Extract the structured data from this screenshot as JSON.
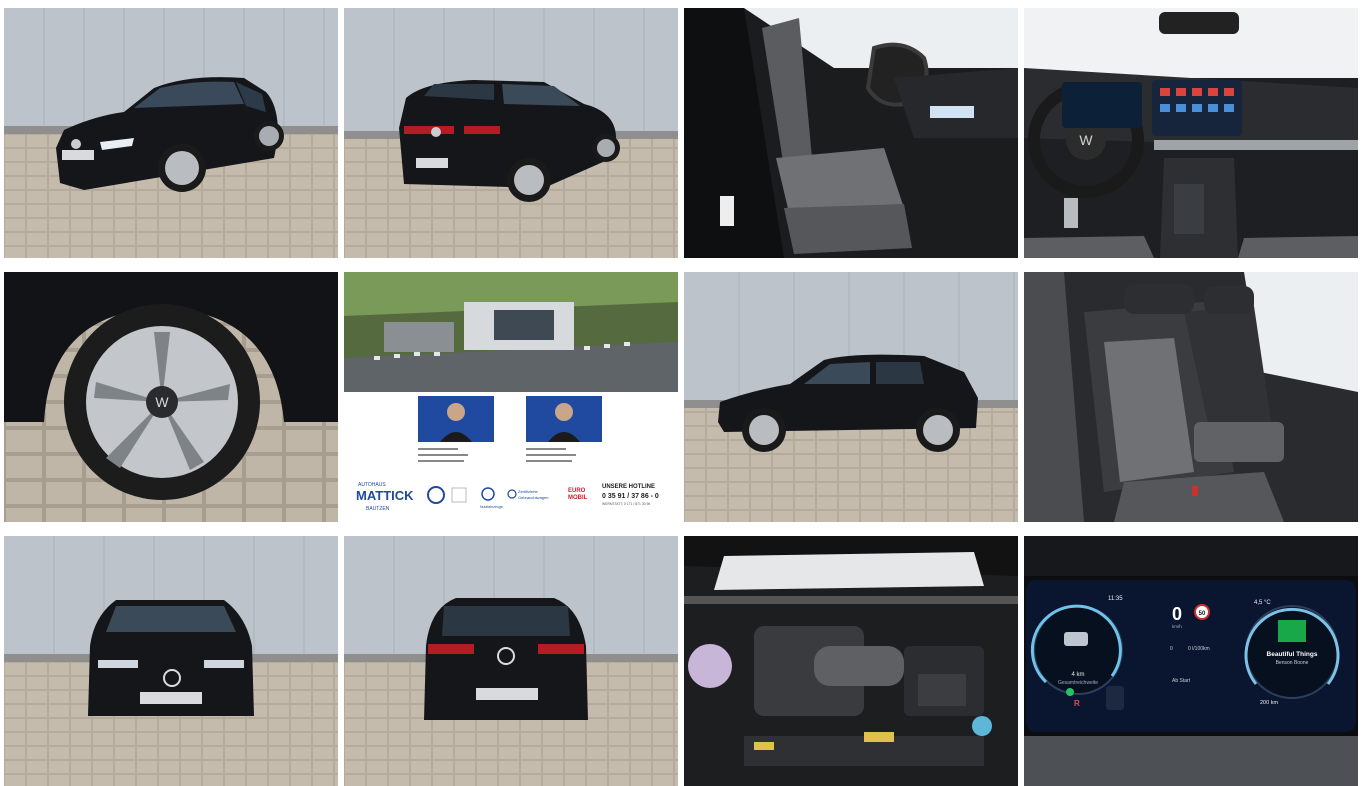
{
  "gallery": {
    "photos": [
      {
        "subject": "front-three-quarter-exterior"
      },
      {
        "subject": "rear-three-quarter-exterior"
      },
      {
        "subject": "driver-seat-interior"
      },
      {
        "subject": "dashboard-cockpit"
      },
      {
        "subject": "alloy-wheel-closeup"
      },
      {
        "subject": "dealer-advertisement"
      },
      {
        "subject": "side-profile-exterior"
      },
      {
        "subject": "rear-seats-interior"
      },
      {
        "subject": "front-view-exterior"
      },
      {
        "subject": "rear-view-exterior"
      },
      {
        "subject": "engine-bay"
      },
      {
        "subject": "digital-instrument-cluster"
      }
    ]
  },
  "dealer_ad": {
    "logo_small_top": "AUTOHAUS",
    "logo_name": "MATTICK",
    "logo_city": "BAUTZEN",
    "vw_label": "Nutzfahrzeuge",
    "certified_line1": "Zertifizierte",
    "certified_line2": "Gebrauchtwagen",
    "euromobil_top": "EURO",
    "euromobil_bottom": "MOBIL",
    "hotline_title": "UNSERE HOTLINE",
    "hotline_number": "0 35 91 / 37 86 - 0",
    "hotline_sub": "WERKSTATT: 0 171 / 871 30 96"
  },
  "cluster": {
    "time": "11:35",
    "temp": "4,5 °C",
    "speed": "0",
    "speed_unit": "km/h",
    "range_line": "4 km",
    "range_label": "Gesamtreichweite",
    "radio_line1": "Beautiful Things",
    "radio_line2": "Benson Boone",
    "ab_start": "Ab Start",
    "trip_dist": "200 km",
    "consumption_label": "0 l/100km",
    "efficiency_value": "0",
    "badge": "R",
    "speed_sign": "50"
  },
  "colors": {
    "car_body": "#141518",
    "wall": "#b8bfc7",
    "pavers": "#b9b0a3",
    "seat_fabric": "#6e7074",
    "screen_bg": "#0a1630",
    "dealer_blue": "#1f4aa0"
  }
}
